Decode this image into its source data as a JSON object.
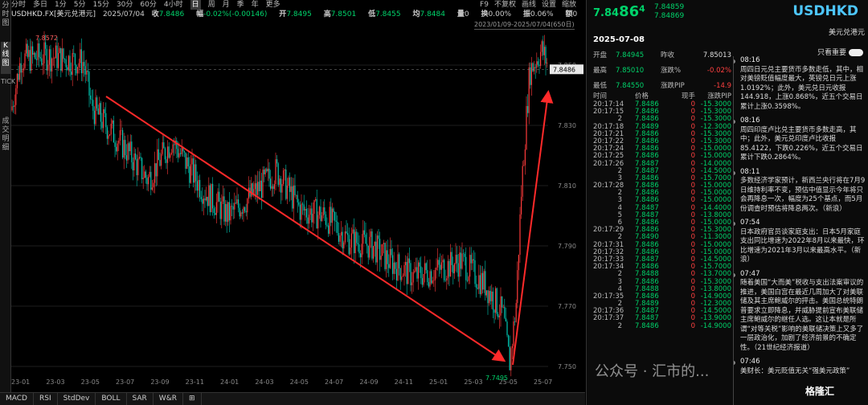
{
  "sidebar": [
    "分时图",
    "K线图",
    "TICK",
    "成交明细"
  ],
  "topbar": {
    "periods": [
      "分时",
      "多日",
      "1分",
      "5分",
      "15分",
      "30分",
      "60分",
      "4小时",
      "日",
      "周",
      "月",
      "季",
      "年",
      "更多"
    ],
    "active": "日",
    "right": [
      "F9",
      "不复权",
      "画线",
      "设置",
      "缩放"
    ]
  },
  "quote": {
    "symbol": "USDHKD.FX[美元兑港元]",
    "date": "2025/07/04",
    "close_label": "收",
    "close": "7.8486",
    "chg_label": "幅",
    "chg": "-0.02%(-0.00146)",
    "open_label": "开",
    "open": "7.8495",
    "high_label": "高",
    "high": "7.8501",
    "low_label": "低",
    "low": "7.8455",
    "avg_label": "均",
    "avg": "7.8484",
    "vol_label": "量",
    "vol": "0",
    "turn_label": "换",
    "turn": "0.00%",
    "amp_label": "振",
    "amp": "0.06%",
    "ratio_label": "额",
    "ratio": "0"
  },
  "range_label": "2023/01/09-2025/07/04(650日)",
  "chart_data": {
    "type": "candlestick",
    "y_ticks": [
      "7.850",
      "7.830",
      "7.810",
      "7.790",
      "7.770",
      "7.750"
    ],
    "x_ticks": [
      "23-01",
      "23-03",
      "23-05",
      "23-07",
      "23-09",
      "23-11",
      "24-01",
      "24-03",
      "24-05",
      "24-07",
      "24-09",
      "24-11",
      "25-01",
      "25-03",
      "25-05",
      "25-07"
    ],
    "high_label": "7.8572",
    "low_label": "7.7495",
    "last_price": "7.8486",
    "colors": {
      "up": "#ff3b3b",
      "down": "#00c8b4",
      "arrow": "#ff2a2a"
    }
  },
  "indicators": [
    "MACD",
    "RSI",
    "StdDev",
    "BOLL",
    "SAR",
    "W&R",
    "⊞"
  ],
  "panel": {
    "price_main": "7.84",
    "price_big": "86",
    "price_sup": "4",
    "bid": "7.84859",
    "ask": "7.84869",
    "symbol": "USDHKD",
    "symbol_name": "美元兑港元",
    "date": "2025-07-08",
    "toggle_label": "只看重要",
    "stats": [
      [
        "开盘",
        "7.84945",
        "昨收",
        "7.85013"
      ],
      [
        "最高",
        "7.85010",
        "涨跌%",
        "-0.02%"
      ],
      [
        "最低",
        "7.84550",
        "涨跌PIP",
        "-14.9"
      ]
    ],
    "tick_headers": [
      "时间",
      "价格",
      "现手",
      "涨跌PIP"
    ],
    "ticks": [
      [
        "20:17:14",
        "7.8486",
        "0",
        "-15.3000"
      ],
      [
        "20:17:15",
        "7.8486",
        "0",
        "-15.3000"
      ],
      [
        "2",
        "7.8486",
        "0",
        "-15.3000"
      ],
      [
        "20:17:18",
        "7.8489",
        "0",
        "-12.3000"
      ],
      [
        "20:17:21",
        "7.8486",
        "0",
        "-15.3000"
      ],
      [
        "20:17:22",
        "7.8486",
        "0",
        "-15.3000"
      ],
      [
        "20:17:24",
        "7.8486",
        "0",
        "-15.0000"
      ],
      [
        "20:17:25",
        "7.8486",
        "0",
        "-15.0000"
      ],
      [
        "20:17:26",
        "7.8487",
        "0",
        "-14.0000"
      ],
      [
        "2",
        "7.8487",
        "0",
        "-14.5000"
      ],
      [
        "3",
        "7.8486",
        "0",
        "-15.7000"
      ],
      [
        "20:17:28",
        "7.8486",
        "0",
        "-15.0000"
      ],
      [
        "2",
        "7.8486",
        "0",
        "-15.0000"
      ],
      [
        "3",
        "7.8486",
        "0",
        "-15.0000"
      ],
      [
        "4",
        "7.8487",
        "0",
        "-14.4000"
      ],
      [
        "5",
        "7.8487",
        "0",
        "-13.8000"
      ],
      [
        "6",
        "7.8486",
        "0",
        "-15.0000"
      ],
      [
        "20:17:29",
        "7.8486",
        "0",
        "-15.3000"
      ],
      [
        "2",
        "7.8490",
        "0",
        "-11.3000"
      ],
      [
        "20:17:31",
        "7.8486",
        "0",
        "-15.0000"
      ],
      [
        "20:17:32",
        "7.8486",
        "0",
        "-15.0000"
      ],
      [
        "20:17:33",
        "7.8487",
        "0",
        "-14.5000"
      ],
      [
        "20:17:34",
        "7.8486",
        "0",
        "-15.7000"
      ],
      [
        "2",
        "7.8488",
        "0",
        "-13.7000"
      ],
      [
        "3",
        "7.8486",
        "0",
        "-15.3000"
      ],
      [
        "4",
        "7.8488",
        "0",
        "-13.8000"
      ],
      [
        "20:17:35",
        "7.8486",
        "0",
        "-14.9000"
      ],
      [
        "2",
        "7.8489",
        "0",
        "-12.3000"
      ],
      [
        "20:17:36",
        "7.8487",
        "0",
        "-14.5000"
      ],
      [
        "20:17:37",
        "7.8487",
        "0",
        "-13.9000"
      ],
      [
        "2",
        "7.8486",
        "0",
        "-14.9000"
      ]
    ],
    "news": [
      {
        "time": "08:16",
        "text": "周四日元兑主要货币多数走低，其中，相对美镑贬值幅度最大，英镑兑日元上涨1.0192%；此外，美元兑日元收报144.918，上涨0.868%，近五个交易日累计上涨0.3598%。"
      },
      {
        "time": "08:16",
        "text": "周四印度卢比兑主要货币多数走高，其中；此外，美元兑印度卢比收报85.4122，下跌0.226%，近五个交易日累计下跌0.2864%。"
      },
      {
        "time": "08:11",
        "text": "多数经济学家预计，新西兰央行将在7月9日维持利率不变，预估中值显示今年将只会再降息一次，幅度为25个基点，而5月份调查时预估将降息两次。（新浪）"
      },
      {
        "time": "07:54",
        "text": "日本政府官员谈家庭支出：日本5月家庭支出同比增速为2022年8月以来最快，环比增速为2021年3月以来最高水平。（新浪）"
      },
      {
        "time": "07:47",
        "text": "随着美国“大而美”税收与支出法案审议的推进，美国白宫在最近几周加大了对美联储及其主席鲍威尔的抨击。美国总统特朗普要求立即降息，并威胁提前宣布美联储主席鲍威尔的继任人选。这让本就是所谓“对等关税”影响的美联储决策上又多了一层政治化，加剧了经济前景的不确定性。（21世纪经济报道）"
      },
      {
        "time": "07:46",
        "text": "美财长：美元贬值无关“强美元政策”"
      }
    ]
  },
  "watermark": "公众号 · 汇市的...",
  "logo": "格隆汇"
}
